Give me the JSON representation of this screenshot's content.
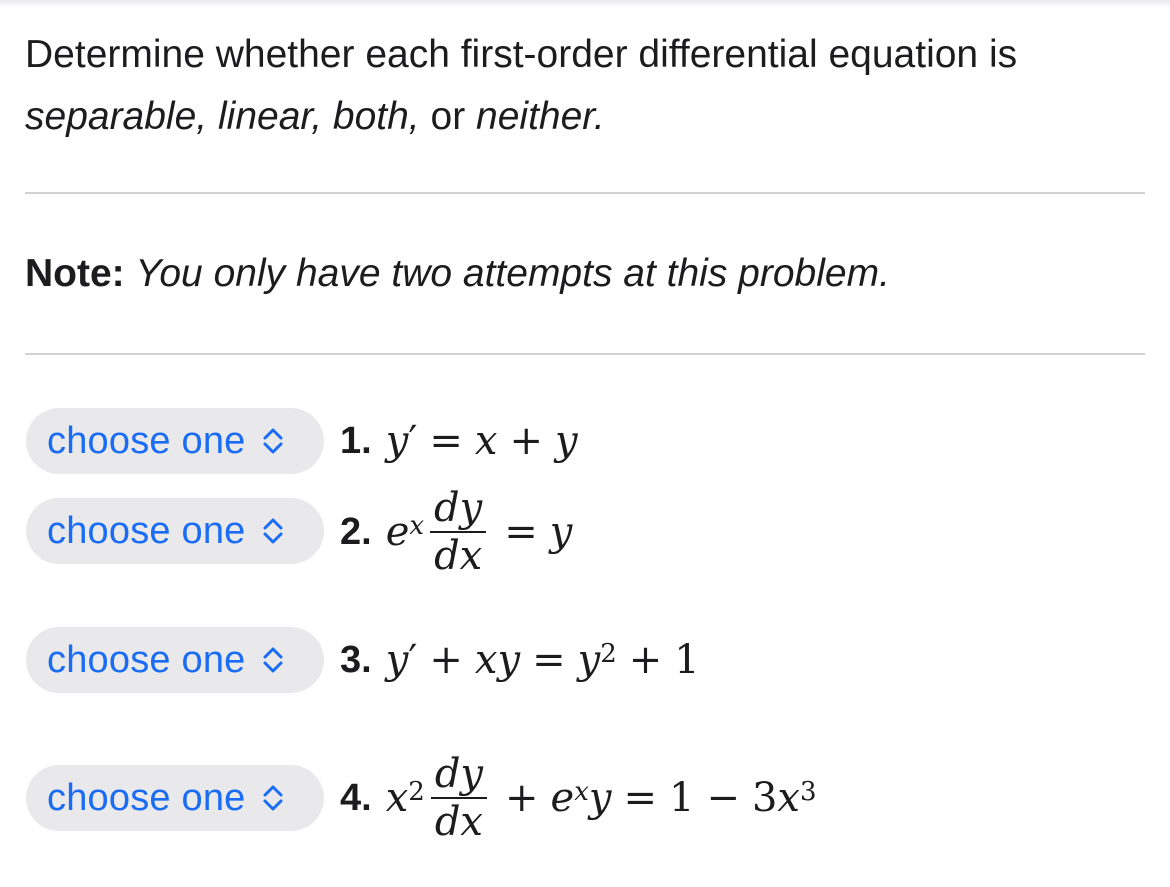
{
  "intro": {
    "line1": "Determine whether each first-order differential equation is",
    "opt_separable": "separable,",
    "opt_linear": "linear,",
    "opt_both": "both,",
    "or_word": "or",
    "opt_neither": "neither."
  },
  "note": {
    "label": "Note:",
    "text": "You only have two attempts at this problem."
  },
  "icons": {
    "select_chevron": "chevron-up-down-icon"
  },
  "colors": {
    "select_text": "#1a6cf5",
    "select_bg": "#e9e9eb"
  },
  "questions": [
    {
      "number": "1.",
      "select_label": "choose one",
      "equation": "y' = x + y",
      "parts": {
        "y": "y",
        "prime": "′",
        "eq": "=",
        "x": "x",
        "plus": "+",
        "y2": "y"
      }
    },
    {
      "number": "2.",
      "select_label": "choose one",
      "equation": "e^x dy/dx = y",
      "parts": {
        "e": "e",
        "exp": "x",
        "num": "dy",
        "den": "dx",
        "eq": "=",
        "rhs": "y"
      }
    },
    {
      "number": "3.",
      "select_label": "choose one",
      "equation": "y' + xy = y^2 + 1",
      "parts": {
        "y": "y",
        "prime": "′",
        "plus1": "+",
        "xy": "xy",
        "eq": "=",
        "y2": "y",
        "sq": "2",
        "plus2": "+",
        "one": "1"
      }
    },
    {
      "number": "4.",
      "select_label": "choose one",
      "equation": "x^2 dy/dx + e^x y = 1 - 3x^3",
      "parts": {
        "x": "x",
        "sq": "2",
        "num": "dy",
        "den": "dx",
        "plus": "+",
        "e": "e",
        "exp": "x",
        "y": "y",
        "eq": "=",
        "one": "1",
        "minus": "−",
        "three": "3",
        "x2": "x",
        "cube": "3"
      }
    }
  ]
}
